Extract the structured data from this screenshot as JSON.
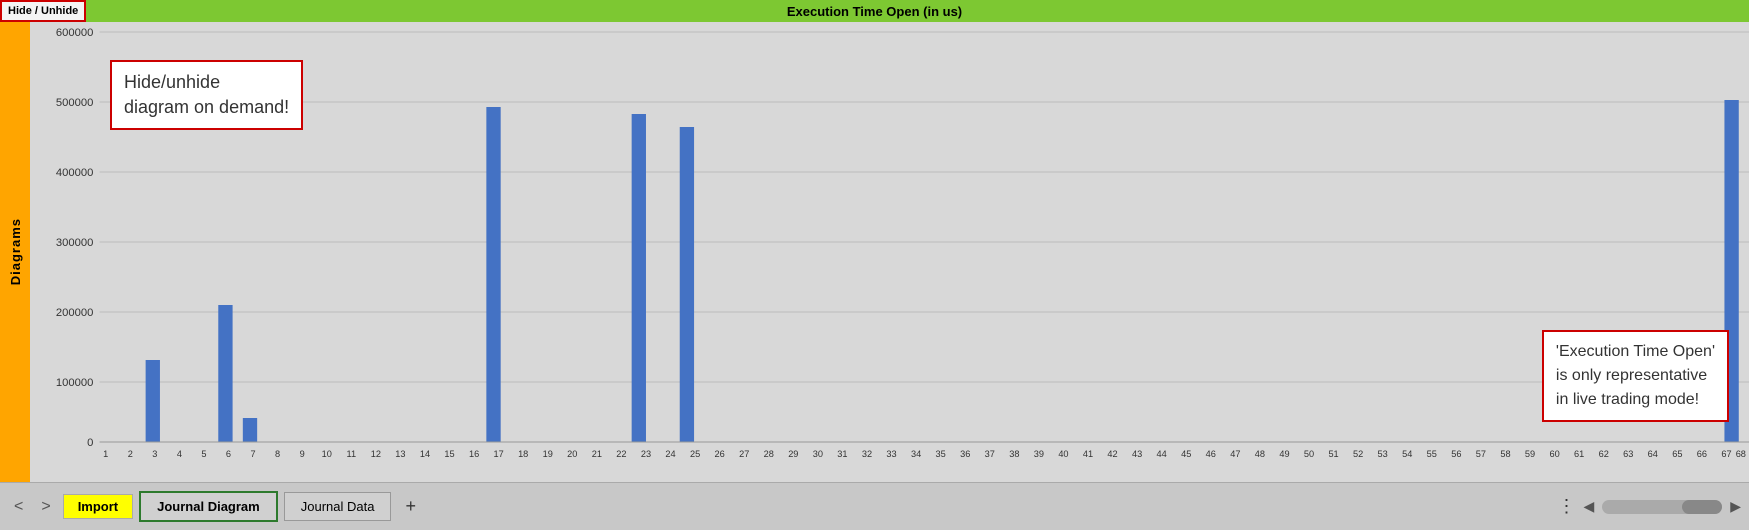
{
  "header": {
    "hide_unhide_label": "Hide / Unhide",
    "chart_title": "Execution Time Open (in us)"
  },
  "sidebar": {
    "label": "Diagrams"
  },
  "tooltips": {
    "hide_diagram": "Hide/unhide\ndiagram on demand!",
    "execution_time": "'Execution Time Open'\nis only representative\nin live trading mode!"
  },
  "chart": {
    "y_axis_labels": [
      "600000",
      "500000",
      "400000",
      "300000",
      "200000",
      "100000",
      "0"
    ],
    "x_axis_labels": [
      "1",
      "2",
      "3",
      "4",
      "5",
      "6",
      "7",
      "8",
      "9",
      "10",
      "11",
      "12",
      "13",
      "14",
      "15",
      "16",
      "17",
      "18",
      "19",
      "20",
      "21",
      "22",
      "23",
      "24",
      "25",
      "26",
      "27",
      "28",
      "29",
      "30",
      "31",
      "32",
      "33",
      "34",
      "35",
      "36",
      "37",
      "38",
      "39",
      "40",
      "41",
      "42",
      "43",
      "44",
      "45",
      "46",
      "47",
      "48",
      "49",
      "50",
      "51",
      "52",
      "53",
      "54",
      "55",
      "56",
      "57",
      "58",
      "59",
      "60",
      "61",
      "62",
      "63",
      "64",
      "65",
      "66",
      "67",
      "68"
    ],
    "bars": [
      {
        "x": 3,
        "value": 120000
      },
      {
        "x": 6,
        "value": 200000
      },
      {
        "x": 7,
        "value": 35000
      },
      {
        "x": 17,
        "value": 490000
      },
      {
        "x": 23,
        "value": 480000
      },
      {
        "x": 25,
        "value": 460000
      },
      {
        "x": 68,
        "value": 500000
      }
    ],
    "max_value": 600000
  },
  "bottom_bar": {
    "nav_back": "<",
    "nav_forward": ">",
    "import_label": "Import",
    "tabs": [
      {
        "label": "Journal Diagram",
        "active": true
      },
      {
        "label": "Journal Data",
        "active": false
      }
    ],
    "plus_label": "+",
    "dots_label": "⋮"
  }
}
